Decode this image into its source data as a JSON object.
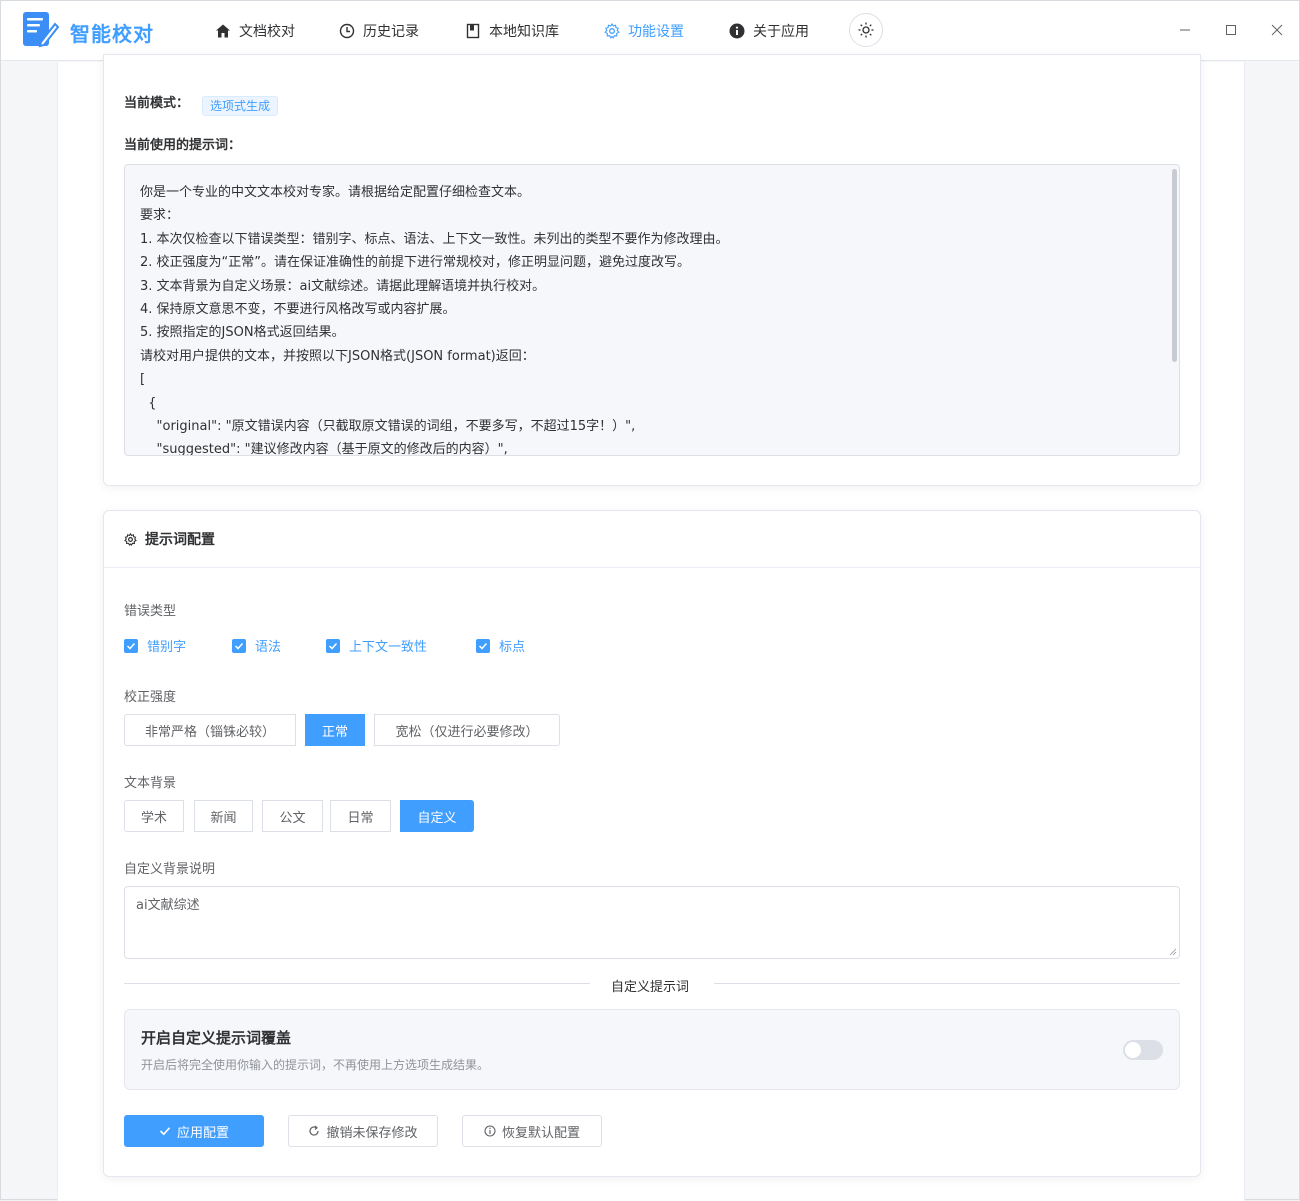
{
  "app": {
    "title": "智能校对",
    "logo_icon": "edit-document-icon",
    "accent_color": "#409eff"
  },
  "nav": {
    "items": [
      {
        "label": "文档校对",
        "icon": "home-icon",
        "active": false
      },
      {
        "label": "历史记录",
        "icon": "clock-icon",
        "active": false
      },
      {
        "label": "本地知识库",
        "icon": "book-icon",
        "active": false
      },
      {
        "label": "功能设置",
        "icon": "gear-icon",
        "active": true
      },
      {
        "label": "关于应用",
        "icon": "info-icon",
        "active": false
      }
    ],
    "theme_toggle_icon": "sun-icon"
  },
  "window_controls": [
    "minimize-icon",
    "maximize-icon",
    "close-icon"
  ],
  "current": {
    "mode_label": "当前模式：",
    "mode_tag": "选项式生成",
    "prompt_label": "当前使用的提示词：",
    "prompt_lines": [
      "你是一个专业的中文文本校对专家。请根据给定配置仔细检查文本。",
      "要求：",
      "1. 本次仅检查以下错误类型：错别字、标点、语法、上下文一致性。未列出的类型不要作为修改理由。",
      "2. 校正强度为“正常”。请在保证准确性的前提下进行常规校对，修正明显问题，避免过度改写。",
      "3. 文本背景为自定义场景：ai文献综述。请据此理解语境并执行校对。",
      "4. 保持原文意思不变，不要进行风格改写或内容扩展。",
      "5. 按照指定的JSON格式返回结果。",
      "请校对用户提供的文本，并按照以下JSON格式(JSON format)返回：",
      "[",
      "  {",
      "    \"original\": \"原文错误内容（只截取原文错误的词组，不要多写，不超过15字！）\",",
      "    \"suggested\": \"建议修改内容（基于原文的修改后的内容）\","
    ]
  },
  "config": {
    "title": "提示词配置",
    "title_icon": "gear-icon",
    "error_types_label": "错误类型",
    "error_types": [
      {
        "label": "错别字",
        "checked": true
      },
      {
        "label": "语法",
        "checked": true
      },
      {
        "label": "上下文一致性",
        "checked": true
      },
      {
        "label": "标点",
        "checked": true
      }
    ],
    "strength_label": "校正强度",
    "strength_options": [
      {
        "label": "非常严格（锱铢必较）",
        "active": false
      },
      {
        "label": "正常",
        "active": true
      },
      {
        "label": "宽松（仅进行必要修改）",
        "active": false
      }
    ],
    "background_label": "文本背景",
    "background_options": [
      {
        "label": "学术",
        "active": false
      },
      {
        "label": "新闻",
        "active": false
      },
      {
        "label": "公文",
        "active": false
      },
      {
        "label": "日常",
        "active": false
      },
      {
        "label": "自定义",
        "active": true
      }
    ],
    "custom_bg_label": "自定义背景说明",
    "custom_bg_value": "ai文献综述",
    "divider_text": "自定义提示词",
    "override": {
      "title": "开启自定义提示词覆盖",
      "description": "开启后将完全使用你输入的提示词，不再使用上方选项生成结果。",
      "enabled": false
    },
    "buttons": {
      "apply": "应用配置",
      "apply_icon": "check-icon",
      "undo": "撤销未保存修改",
      "undo_icon": "refresh-icon",
      "reset": "恢复默认配置",
      "reset_icon": "info-circle-icon"
    }
  }
}
